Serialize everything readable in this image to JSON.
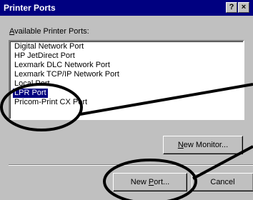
{
  "window": {
    "title": "Printer Ports",
    "help_glyph": "?",
    "close_glyph": "×"
  },
  "ports": {
    "label_prefix": "",
    "label_accel": "A",
    "label_rest": "vailable Printer Ports:",
    "items": [
      "Digital Network Port",
      "HP JetDirect Port",
      "Lexmark DLC Network Port",
      "Lexmark TCP/IP Network Port",
      "Local Port",
      "LPR Port",
      "Pricom-Print CX Port"
    ],
    "selected_index": 5
  },
  "buttons": {
    "new_monitor_prefix": "",
    "new_monitor_accel": "N",
    "new_monitor_rest": "ew Monitor...",
    "new_port_prefix": "New ",
    "new_port_accel": "P",
    "new_port_rest": "ort...",
    "cancel": "Cancel"
  },
  "annotation": {
    "color": "#000000"
  }
}
